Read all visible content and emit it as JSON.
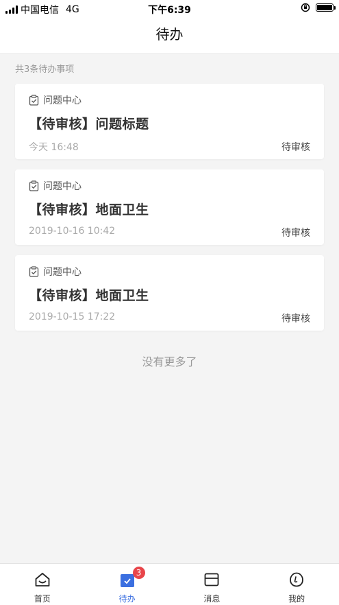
{
  "status_bar": {
    "carrier": "中国电信",
    "network": "4G",
    "time": "下午6:39"
  },
  "nav": {
    "title": "待办"
  },
  "summary": {
    "count_text": "共3条待办事项"
  },
  "cards": [
    {
      "category": "问题中心",
      "title": "【待审核】问题标题",
      "time": "今天 16:48",
      "status": "待审核"
    },
    {
      "category": "问题中心",
      "title": "【待审核】地面卫生",
      "time": "2019-10-16 10:42",
      "status": "待审核"
    },
    {
      "category": "问题中心",
      "title": "【待审核】地面卫生",
      "time": "2019-10-15 17:22",
      "status": "待审核"
    }
  ],
  "footer": {
    "no_more": "没有更多了"
  },
  "tabs": [
    {
      "label": "首页",
      "icon": "home-icon"
    },
    {
      "label": "待办",
      "icon": "todo-icon",
      "badge": "3",
      "active": true
    },
    {
      "label": "消息",
      "icon": "message-icon"
    },
    {
      "label": "我的",
      "icon": "profile-icon"
    }
  ],
  "colors": {
    "accent": "#3b6fe0",
    "badge": "#e8454a",
    "background": "#f4f4f4"
  }
}
